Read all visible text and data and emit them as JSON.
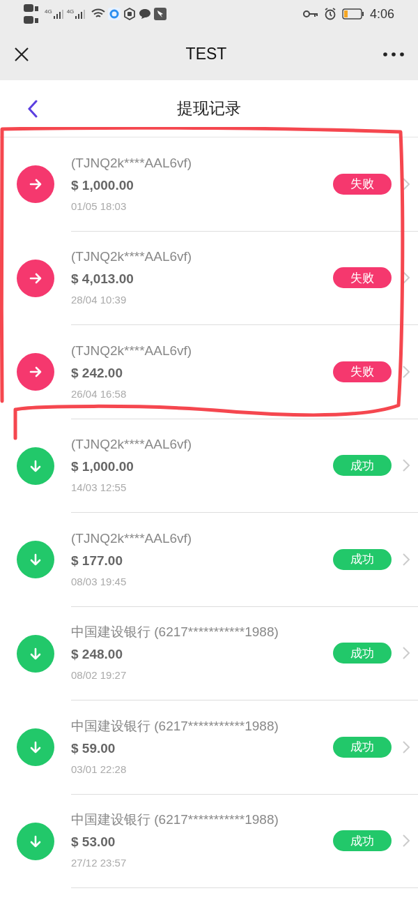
{
  "status_bar": {
    "signal_labels": [
      "4G",
      "4G"
    ],
    "time": "4:06"
  },
  "header": {
    "title": "TEST"
  },
  "subheader": {
    "title": "提现记录"
  },
  "records": [
    {
      "kind": "failed",
      "account": "(TJNQ2k****AAL6vf)",
      "amount": "$ 1,000.00",
      "time": "01/05 18:03",
      "status": "失败"
    },
    {
      "kind": "failed",
      "account": "(TJNQ2k****AAL6vf)",
      "amount": "$ 4,013.00",
      "time": "28/04 10:39",
      "status": "失败"
    },
    {
      "kind": "failed",
      "account": "(TJNQ2k****AAL6vf)",
      "amount": "$ 242.00",
      "time": "26/04 16:58",
      "status": "失败"
    },
    {
      "kind": "success",
      "account": "(TJNQ2k****AAL6vf)",
      "amount": "$ 1,000.00",
      "time": "14/03 12:55",
      "status": "成功"
    },
    {
      "kind": "success",
      "account": "(TJNQ2k****AAL6vf)",
      "amount": "$ 177.00",
      "time": "08/03 19:45",
      "status": "成功"
    },
    {
      "kind": "success",
      "account": "中国建设银行 (6217***********1988)",
      "amount": "$ 248.00",
      "time": "08/02 19:27",
      "status": "成功"
    },
    {
      "kind": "success",
      "account": "中国建设银行 (6217***********1988)",
      "amount": "$ 59.00",
      "time": "03/01 22:28",
      "status": "成功"
    },
    {
      "kind": "success",
      "account": "中国建设银行 (6217***********1988)",
      "amount": "$ 53.00",
      "time": "27/12 23:57",
      "status": "成功"
    }
  ]
}
